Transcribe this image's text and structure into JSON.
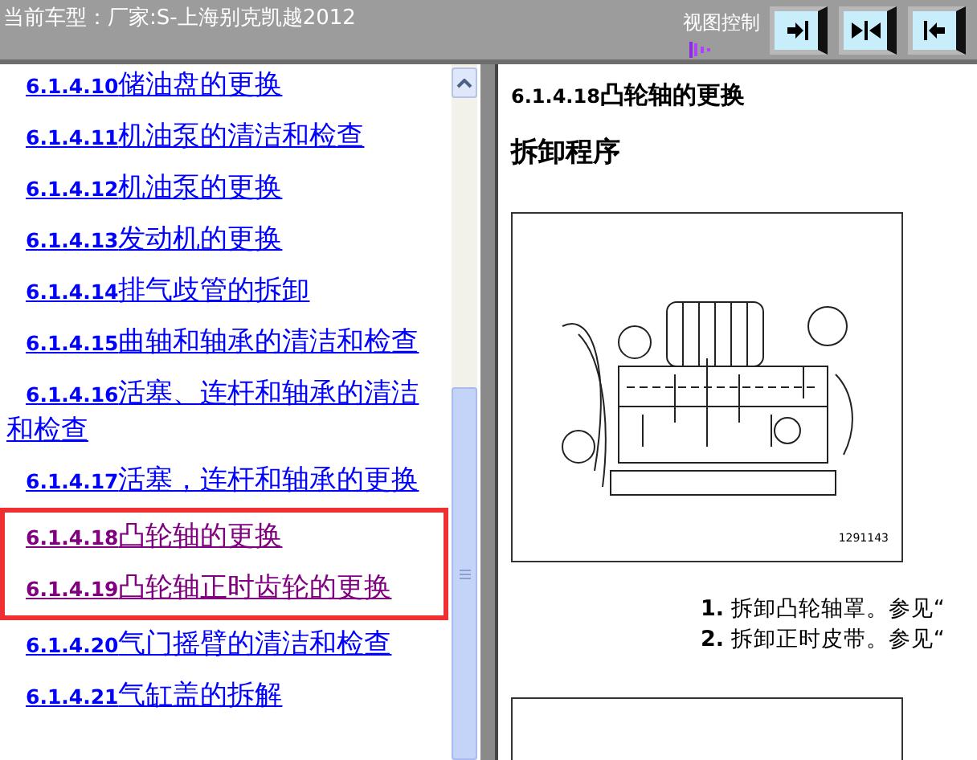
{
  "top_bar": {
    "vehicle_label": "当前车型：厂家:S-上海别克凯越2012",
    "view_control_label": "视图控制",
    "view_buttons": [
      {
        "kind": "right"
      },
      {
        "kind": "split"
      },
      {
        "kind": "left"
      }
    ]
  },
  "toc": {
    "items": [
      {
        "number": "6.1.4.10",
        "title": "储油盘的更换",
        "visited": false,
        "highlighted": false
      },
      {
        "number": "6.1.4.11",
        "title": "机油泵的清洁和检查",
        "visited": false,
        "highlighted": false
      },
      {
        "number": "6.1.4.12",
        "title": "机油泵的更换",
        "visited": false,
        "highlighted": false
      },
      {
        "number": "6.1.4.13",
        "title": "发动机的更换",
        "visited": false,
        "highlighted": false
      },
      {
        "number": "6.1.4.14",
        "title": "排气歧管的拆卸",
        "visited": false,
        "highlighted": false
      },
      {
        "number": "6.1.4.15",
        "title": "曲轴和轴承的清洁和检查",
        "visited": false,
        "highlighted": false
      },
      {
        "number": "6.1.4.16",
        "title": "活塞、连杆和轴承的清洁和检查",
        "visited": false,
        "highlighted": false
      },
      {
        "number": "6.1.4.17",
        "title": "活塞，连杆和轴承的更换",
        "visited": false,
        "highlighted": false
      },
      {
        "number": "6.1.4.18",
        "title": "凸轮轴的更换",
        "visited": true,
        "highlighted": true
      },
      {
        "number": "6.1.4.19",
        "title": "凸轮轴正时齿轮的更换",
        "visited": true,
        "highlighted": true
      },
      {
        "number": "6.1.4.20",
        "title": "气门摇臂的清洁和检查",
        "visited": false,
        "highlighted": false
      },
      {
        "number": "6.1.4.21",
        "title": "气缸盖的拆解",
        "visited": false,
        "highlighted": false
      }
    ]
  },
  "document": {
    "heading_number": "6.1.4.18",
    "heading_title": "凸轮轴的更换",
    "section_title": "拆卸程序",
    "figure_caption": "1291143",
    "steps": [
      {
        "number": "1.",
        "text": "拆卸凸轮轴罩。参见“"
      },
      {
        "number": "2.",
        "text": "拆卸正时皮带。参见“"
      }
    ]
  }
}
